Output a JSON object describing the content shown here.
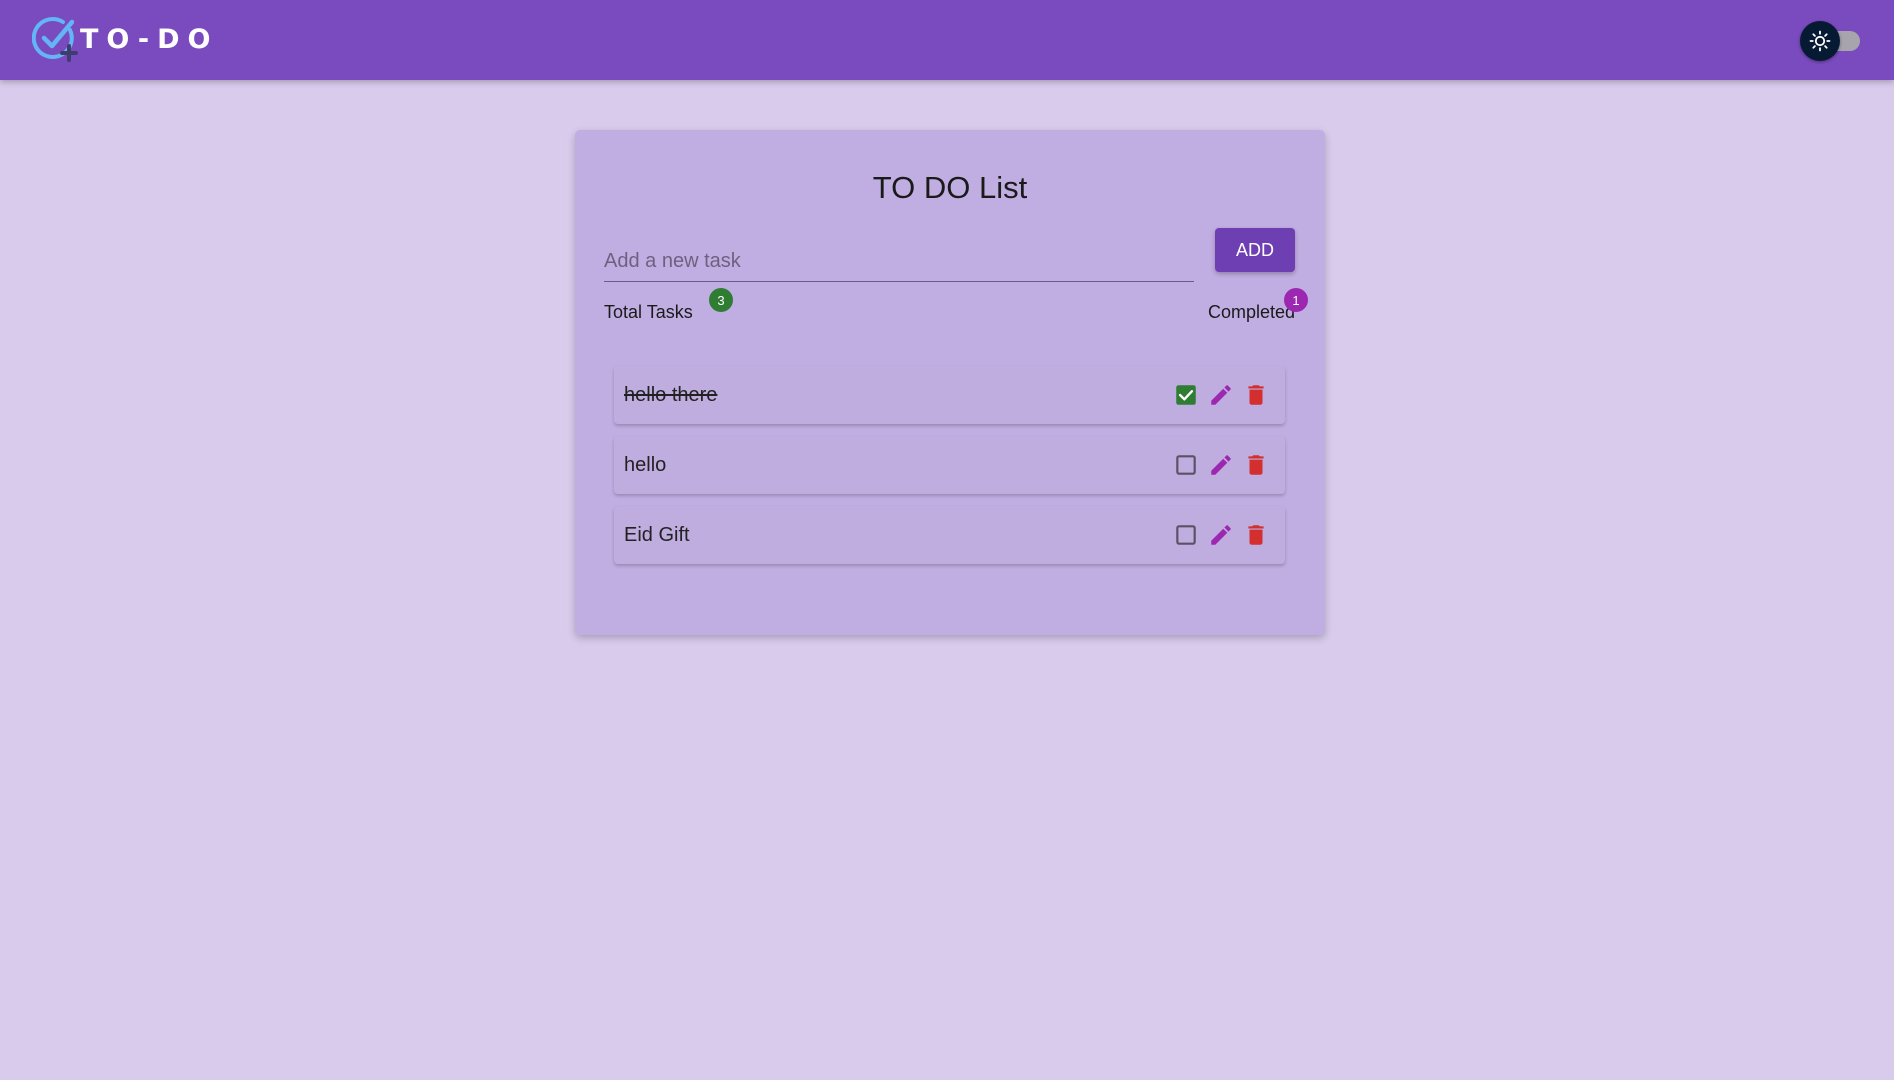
{
  "app": {
    "name": "TO-DO"
  },
  "card": {
    "title": "TO DO List",
    "input_placeholder": "Add a new task",
    "add_label": "ADD"
  },
  "stats": {
    "total_label": "Total Tasks",
    "total_count": "3",
    "completed_label": "Completed",
    "completed_count": "1"
  },
  "tasks": [
    {
      "text": "hello there",
      "completed": true
    },
    {
      "text": "hello",
      "completed": false
    },
    {
      "text": "Eid Gift",
      "completed": false
    }
  ],
  "theme": {
    "mode": "light"
  },
  "colors": {
    "appbar": "#7a4bbe",
    "background": "#d8cbec",
    "card": "#c0ade1",
    "accent": "#6e3fb2",
    "badge_total": "#2e7d32",
    "badge_completed": "#9c27b0",
    "edit_icon": "#9c27b0",
    "delete_icon": "#d32f2f",
    "checked": "#2e7d32"
  },
  "icons": {
    "logo": "check-circle-plus-icon",
    "theme": "sun-icon",
    "checked": "checkbox-checked-icon",
    "unchecked": "checkbox-unchecked-icon",
    "edit": "pencil-icon",
    "delete": "trash-icon"
  }
}
